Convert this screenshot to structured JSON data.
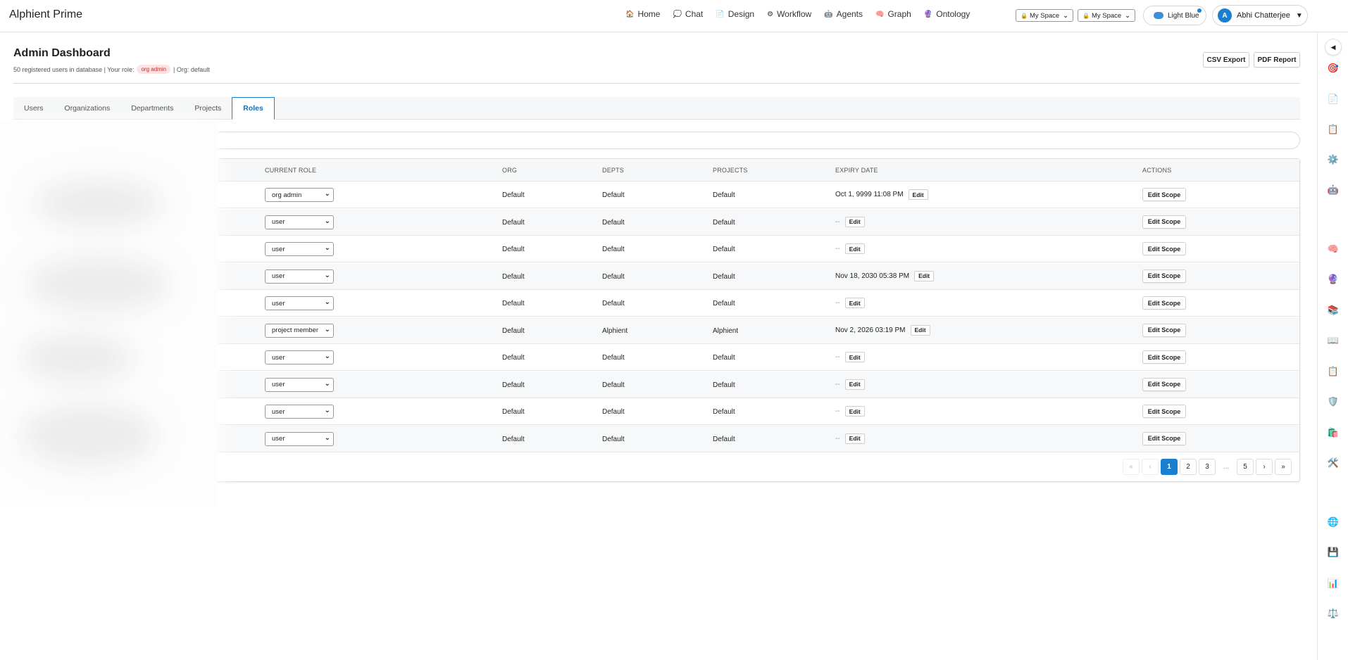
{
  "brand": "Alphient Prime",
  "nav": [
    {
      "label": "Home",
      "icon": "🏠"
    },
    {
      "label": "Chat",
      "icon": "💭"
    },
    {
      "label": "Design",
      "icon": "📄"
    },
    {
      "label": "Workflow",
      "icon": "⚙"
    },
    {
      "label": "Agents",
      "icon": "🤖"
    },
    {
      "label": "Graph",
      "icon": "🧠"
    },
    {
      "label": "Ontology",
      "icon": "🔮"
    }
  ],
  "space_selects": [
    {
      "label": "My Space",
      "icon": "🔒"
    },
    {
      "label": "My Space",
      "icon": "🔒"
    }
  ],
  "theme": {
    "label": "Light Blue"
  },
  "user": {
    "initial": "A",
    "name": "Abhi Chatterjee",
    "caret": "▼"
  },
  "header": {
    "title": "Admin Dashboard",
    "subtitle_prefix": "50 registered users in database | Your role:",
    "role_badge": "org admin",
    "subtitle_suffix": "| Org: default",
    "csv_export": "CSV Export",
    "pdf_report": "PDF Report"
  },
  "tabs": [
    {
      "label": "Users",
      "active": false
    },
    {
      "label": "Organizations",
      "active": false
    },
    {
      "label": "Departments",
      "active": false
    },
    {
      "label": "Projects",
      "active": false
    },
    {
      "label": "Roles",
      "active": true
    }
  ],
  "table": {
    "columns": {
      "current_role": "CURRENT ROLE",
      "org": "ORG",
      "depts": "DEPTS",
      "projects": "PROJECTS",
      "expiry": "EXPIRY DATE",
      "actions": "ACTIONS"
    },
    "edit_label": "Edit",
    "scope_label": "Edit Scope",
    "rows": [
      {
        "role": "org admin",
        "org": "Default",
        "depts": "Default",
        "projects": "Default",
        "expiry": "Oct 1, 9999 11:08 PM"
      },
      {
        "role": "user",
        "org": "Default",
        "depts": "Default",
        "projects": "Default",
        "expiry": "--"
      },
      {
        "role": "user",
        "org": "Default",
        "depts": "Default",
        "projects": "Default",
        "expiry": "--"
      },
      {
        "role": "user",
        "org": "Default",
        "depts": "Default",
        "projects": "Default",
        "expiry": "Nov 18, 2030 05:38 PM"
      },
      {
        "role": "user",
        "org": "Default",
        "depts": "Default",
        "projects": "Default",
        "expiry": "--"
      },
      {
        "role": "project member",
        "org": "Default",
        "depts": "Alphient",
        "projects": "Alphient",
        "expiry": "Nov 2, 2026 03:19 PM"
      },
      {
        "role": "user",
        "org": "Default",
        "depts": "Default",
        "projects": "Default",
        "expiry": "--"
      },
      {
        "role": "user",
        "org": "Default",
        "depts": "Default",
        "projects": "Default",
        "expiry": "--"
      },
      {
        "role": "user",
        "org": "Default",
        "depts": "Default",
        "projects": "Default",
        "expiry": "--"
      },
      {
        "role": "user",
        "org": "Default",
        "depts": "Default",
        "projects": "Default",
        "expiry": "--"
      }
    ]
  },
  "pagination": {
    "first": "«",
    "prev": "‹",
    "pages": [
      "1",
      "2",
      "3"
    ],
    "ellipsis": "...",
    "last_page": "5",
    "next": "›",
    "last": "»",
    "current": "1"
  },
  "right_sidebar": {
    "collapse": "◀",
    "icons": [
      "🎯",
      "📄",
      "📋",
      "⚙️",
      "🤖",
      "🧠",
      "🔮",
      "📚",
      "📖",
      "📋",
      "🛡️",
      "🛍️",
      "🛠️",
      "🌐",
      "💾",
      "📊",
      "⚖️"
    ]
  }
}
